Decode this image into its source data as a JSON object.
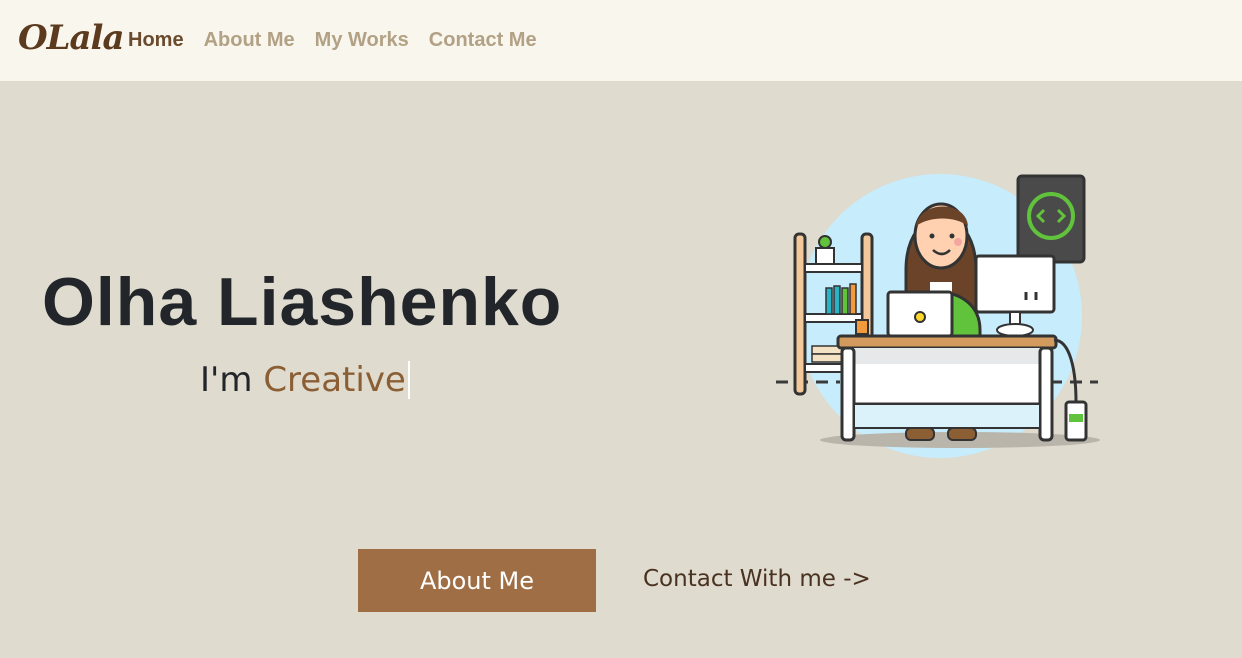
{
  "brand": {
    "logo": "OLala"
  },
  "nav": {
    "items": [
      {
        "label": "Home",
        "active": true
      },
      {
        "label": "About Me",
        "active": false
      },
      {
        "label": "My Works",
        "active": false
      },
      {
        "label": "Contact Me",
        "active": false
      }
    ]
  },
  "hero": {
    "name": "Olha Liashenko",
    "subtitle_prefix": "I'm",
    "subtitle_word": "Creative",
    "illustration": "woman-at-desk-illustration"
  },
  "actions": {
    "primary_label": "About Me",
    "secondary_label": "Contact With me ->"
  },
  "colors": {
    "background": "#dfdbcf",
    "navbar": "#f9f6ee",
    "accent": "#a06e44",
    "text_dark": "#22252a"
  }
}
